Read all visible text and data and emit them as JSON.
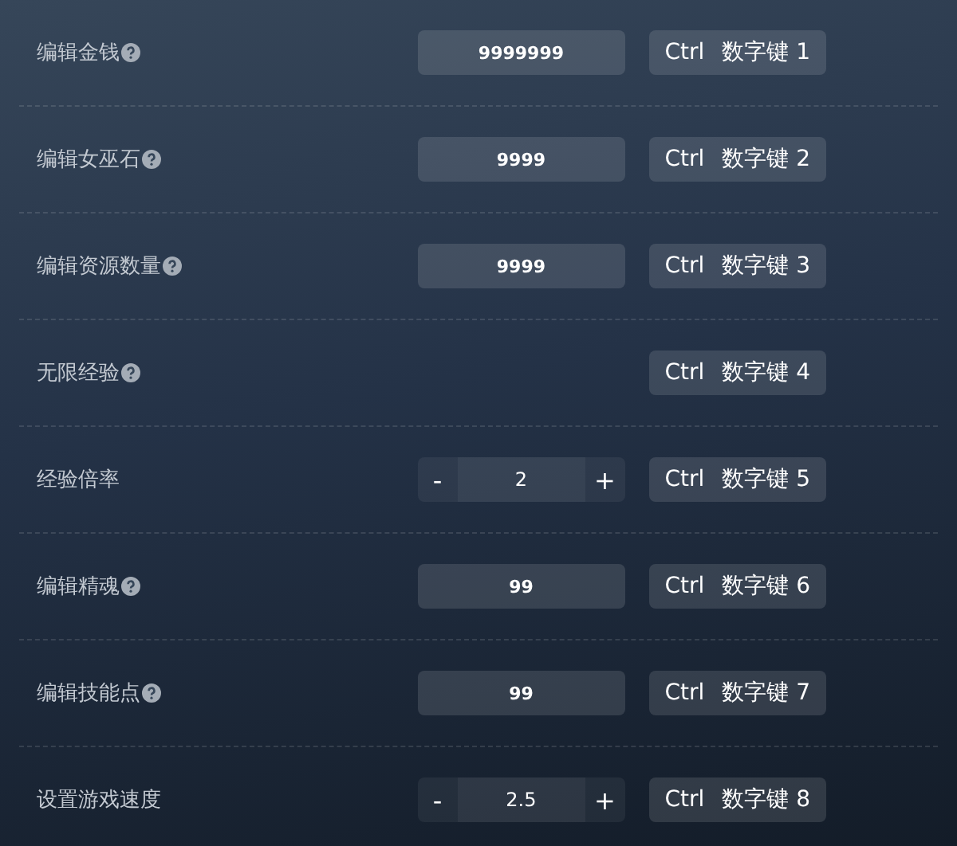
{
  "options": [
    {
      "label": "编辑金钱",
      "help": true,
      "kind": "input",
      "value": "9999999",
      "hotkey": {
        "modifier": "Ctrl",
        "key": "数字键 1"
      }
    },
    {
      "label": "编辑女巫石",
      "help": true,
      "kind": "input",
      "value": "9999",
      "hotkey": {
        "modifier": "Ctrl",
        "key": "数字键 2"
      }
    },
    {
      "label": "编辑资源数量",
      "help": true,
      "kind": "input",
      "value": "9999",
      "hotkey": {
        "modifier": "Ctrl",
        "key": "数字键 3"
      }
    },
    {
      "label": "无限经验",
      "help": true,
      "kind": "toggle",
      "hotkey": {
        "modifier": "Ctrl",
        "key": "数字键 4"
      }
    },
    {
      "label": "经验倍率",
      "help": false,
      "kind": "stepper",
      "value": "2",
      "decrement": "-",
      "increment": "+",
      "hotkey": {
        "modifier": "Ctrl",
        "key": "数字键 5"
      }
    },
    {
      "label": "编辑精魂",
      "help": true,
      "kind": "input",
      "value": "99",
      "hotkey": {
        "modifier": "Ctrl",
        "key": "数字键 6"
      }
    },
    {
      "label": "编辑技能点",
      "help": true,
      "kind": "input",
      "value": "99",
      "hotkey": {
        "modifier": "Ctrl",
        "key": "数字键 7"
      }
    },
    {
      "label": "设置游戏速度",
      "help": false,
      "kind": "stepper",
      "value": "2.5",
      "decrement": "-",
      "increment": "+",
      "hotkey": {
        "modifier": "Ctrl",
        "key": "数字键 8"
      }
    }
  ]
}
